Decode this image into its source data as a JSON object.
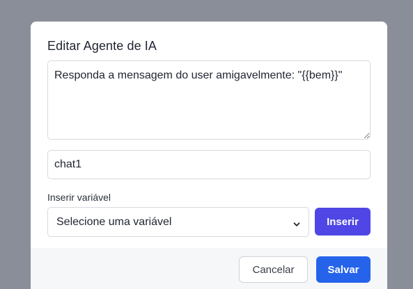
{
  "modal": {
    "title": "Editar Agente de IA",
    "prompt_value": "Responda a mensagem do user amigavelmente: \"{{bem}}\"",
    "name_value": "chat1",
    "variable_label": "Inserir variável",
    "variable_select_value": "Selecione uma variável",
    "insert_label": "Inserir",
    "cancel_label": "Cancelar",
    "save_label": "Salvar"
  },
  "icons": {
    "select_arrow": "chevron-down-icon"
  },
  "colors": {
    "insert_button": "#4f46e5",
    "save_button": "#2563eb",
    "overlay": "#8a8e98"
  }
}
